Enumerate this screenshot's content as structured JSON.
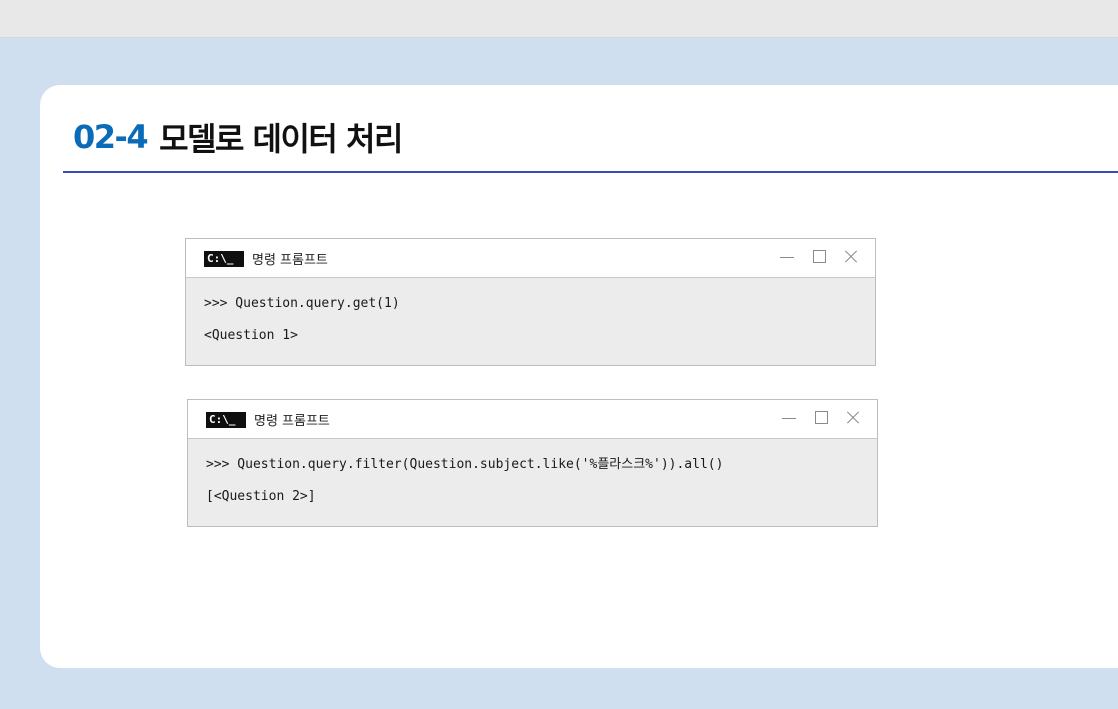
{
  "section": {
    "number": "02-4",
    "title": "모델로 데이터 처리"
  },
  "consoles": [
    {
      "icon_label": "C:\\_",
      "title": "명령 프롬프트",
      "lines": [
        ">>> Question.query.get(1)",
        "<Question 1>"
      ]
    },
    {
      "icon_label": "C:\\_",
      "title": "명령 프롬프트",
      "lines": [
        ">>> Question.query.filter(Question.subject.like('%플라스크%')).all()",
        "[<Question 2>]"
      ]
    }
  ],
  "icons": {
    "minimize": "minimize-icon",
    "maximize": "maximize-icon",
    "close": "close-icon",
    "terminal": "cmd-prompt-icon"
  },
  "colors": {
    "page_background": "#cfdff0",
    "heading_number": "#0a6cb8",
    "heading_rule": "#3b4bb0",
    "console_background": "#ececec"
  }
}
